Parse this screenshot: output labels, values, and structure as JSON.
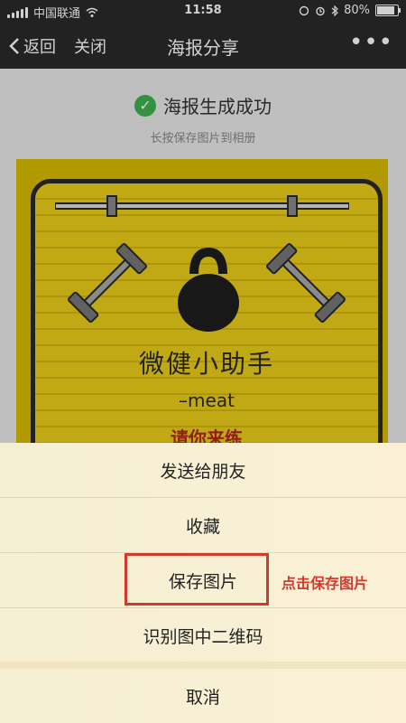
{
  "status_bar": {
    "carrier": "中国联通",
    "time": "11:58",
    "battery_percent": "80%"
  },
  "nav": {
    "back_label": "返回",
    "close_label": "关闭",
    "title": "海报分享",
    "more_label": "•••"
  },
  "success": {
    "check": "✓",
    "message": "海报生成成功",
    "hint": "长按保存图片到相册"
  },
  "poster": {
    "title": "微健小助手",
    "subtitle": "–meat",
    "invite": "请你来练"
  },
  "action_sheet": {
    "items": [
      "发送给朋友",
      "收藏",
      "保存图片",
      "识别图中二维码"
    ],
    "cancel_label": "取消"
  },
  "annotation": {
    "text": "点击保存图片"
  },
  "colors": {
    "accent_red": "#d23a2d",
    "poster_yellow": "#ebcf1a",
    "success_green": "#3fb34f"
  }
}
